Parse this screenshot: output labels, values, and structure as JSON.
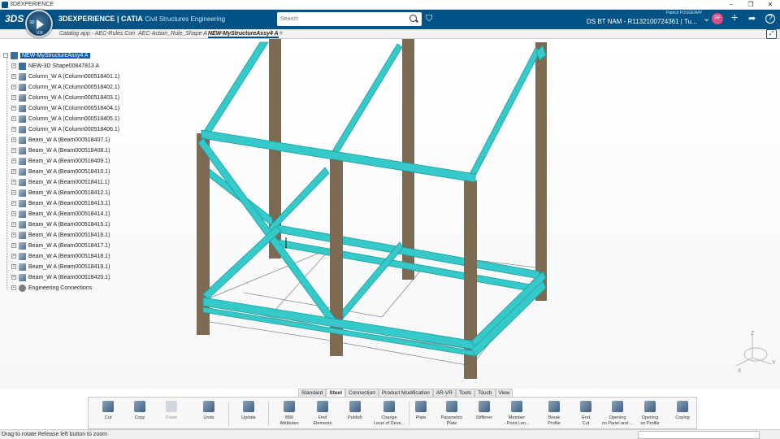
{
  "window": {
    "title": "3DEXPERIENCE"
  },
  "header": {
    "brand_strong": "3DEXPERIENCE | CATIA",
    "brand_sub": "Civil Structures Engineering",
    "compass_label": "3D",
    "compass_version": "V.R",
    "search_placeholder": "Search",
    "user_name": "Patrick FOUGERAY",
    "context": "DS BT NAM - R1132100724361 | Tu...",
    "avatar_initials": "PF"
  },
  "tabs": [
    {
      "label": "Catalog app - AEC-Rules Con"
    },
    {
      "label": "AEC-Action_Rule_Shape A"
    },
    {
      "label": "NEW-MyStructureAssy4 A"
    }
  ],
  "tree": {
    "root": "NEW-MyStructureAssy4 A",
    "items": [
      "NEW-3D Shape00847813 A",
      "Column_W A (Column000518401.1)",
      "Column_W A (Column000518402.1)",
      "Column_W A (Column000518403.1)",
      "Column_W A (Column000518404.1)",
      "Column_W A (Column000518405.1)",
      "Column_W A (Column000518406.1)",
      "Beam_W A (Beam000518407.1)",
      "Beam_W A (Beam000518408.1)",
      "Beam_W A (Beam000518409.1)",
      "Beam_W A (Beam000518410.1)",
      "Beam_W A (Beam000518411.1)",
      "Beam_W A (Beam000518412.1)",
      "Beam_W A (Beam000518413.1)",
      "Beam_W A (Beam000518414.1)",
      "Beam_W A (Beam000518415.1)",
      "Beam_W A (Beam000518416.1)",
      "Beam_W A (Beam000518417.1)",
      "Beam_W A (Beam000518418.1)",
      "Beam_W A (Beam000518419.1)",
      "Beam_W A (Beam000518420.1)",
      "Engineering Connections"
    ]
  },
  "ribbon": {
    "tabs": [
      "Standard",
      "Steel",
      "Connection",
      "Product Modification",
      "AR-VR",
      "Tools",
      "Touch",
      "View"
    ],
    "active_tab": "Steel",
    "buttons": [
      {
        "label": "Cut"
      },
      {
        "label": "Copy"
      },
      {
        "label": "Paste"
      },
      {
        "label": "Undo"
      },
      {
        "label": "Update"
      },
      {
        "label": "BIM\nAttributes"
      },
      {
        "label": "Find\nElements"
      },
      {
        "label": "Publish"
      },
      {
        "label": "Change\nLevel of Deve..."
      },
      {
        "label": "Plate"
      },
      {
        "label": "Parametric\nPlate"
      },
      {
        "label": "Stiffener"
      },
      {
        "label": "Member\n- Point Len..."
      },
      {
        "label": "Break\nProfile"
      },
      {
        "label": "End\nCut"
      },
      {
        "label": "Opening\non Panel and ..."
      },
      {
        "label": "Opening\non Profile"
      },
      {
        "label": "Coping"
      }
    ]
  },
  "axes": {
    "x": "X",
    "y": "Y",
    "z": "Z"
  },
  "status": {
    "text": "Drag to rotate  Release left button to zoom"
  },
  "colors": {
    "header": "#005386",
    "beam": "#35c9c9",
    "column": "#7d6a52",
    "selection": "#0b5cad"
  }
}
